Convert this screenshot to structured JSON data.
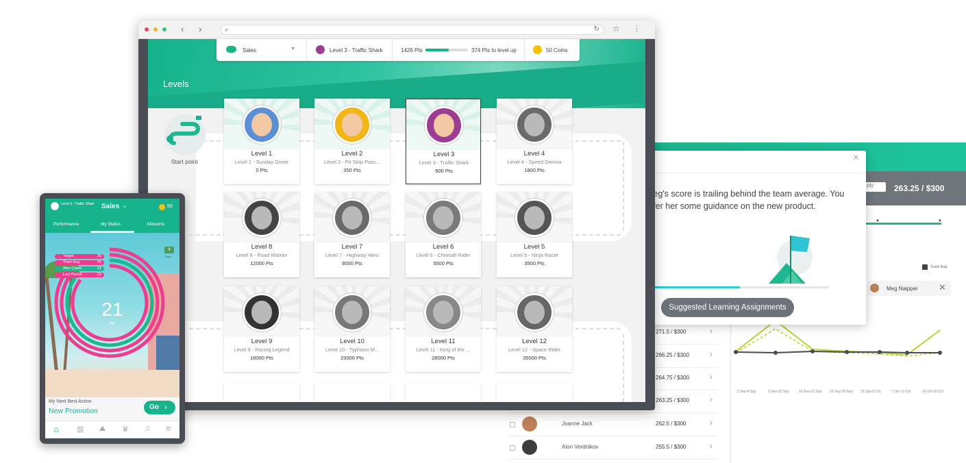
{
  "dashboard": {
    "score": "263.25 / $300",
    "period_select": "ply",
    "team_avg_label": "Team Avg.",
    "compare_user": "Meg Naipper",
    "dates": [
      "2 Sep-8 Sep",
      "9 Sep-15 Sep",
      "16 Sep-22 Sep",
      "23 Sep-29 Sep",
      "30 Sep-6 Oct",
      "7 Oct-13 Oct",
      "14 Oct-20 Oct"
    ],
    "rows": [
      {
        "name": "",
        "score": "271.5 / $300"
      },
      {
        "name": "",
        "score": "266.25 / $300"
      },
      {
        "name": "",
        "score": "264.75 / $300"
      },
      {
        "name": "",
        "score": "263.25 / $300"
      },
      {
        "name": "Joanne Jack",
        "score": "262.5 / $300"
      },
      {
        "name": "Alon Verdnikov",
        "score": "255.5 / $300"
      }
    ]
  },
  "popup": {
    "message": "Meg's score is trailing behind the team average. You offer her some guidance on the new product.",
    "button": "Suggested Learning Assignments"
  },
  "topbar": {
    "team": "Sales",
    "level": "Level 3 - Traffic Shark",
    "points": "1426 Pts",
    "progress": 0.55,
    "to_level_up": "374 Pts to level up",
    "coins": "50 Coins"
  },
  "levels_page": {
    "title": "Levels",
    "start_label": "Start point"
  },
  "levels": [
    {
      "level": "Level 1",
      "name": "Level 1 - Sunday Driver",
      "pts": "0 Pts",
      "color": "#5b8fd6"
    },
    {
      "level": "Level 2",
      "name": "Level 2 - Pit Stop Pass...",
      "pts": "350 Pts",
      "color": "#f2b619"
    },
    {
      "level": "Level 3",
      "name": "Level 3 - Traffic Shark",
      "pts": "900 Pts",
      "color": "#9c3d93"
    },
    {
      "level": "Level 4",
      "name": "Level 4 - Speed Demon",
      "pts": "1800 Pts",
      "color": "#6a6a6a"
    },
    {
      "level": "Level 8",
      "name": "Level 8 - Road Warrior",
      "pts": "12000 Pts",
      "color": "#444444"
    },
    {
      "level": "Level 7",
      "name": "Level 7 - Highway Hero",
      "pts": "8000 Pts",
      "color": "#6a6a6a"
    },
    {
      "level": "Level 6",
      "name": "Level 6 - Cheetah Rider",
      "pts": "5500 Pts",
      "color": "#7a7a7a"
    },
    {
      "level": "Level 5",
      "name": "Level 5 - Ninja Racer",
      "pts": "3500 Pts",
      "color": "#555555"
    },
    {
      "level": "Level 9",
      "name": "Level 9 - Racing Legend",
      "pts": "18000 Pts",
      "color": "#333333"
    },
    {
      "level": "Level 10",
      "name": "Level 10 - Typhoon M...",
      "pts": "23000 Pts",
      "color": "#777777"
    },
    {
      "level": "Level 11",
      "name": "Level 11 - King of the ...",
      "pts": "28000 Pts",
      "color": "#888888"
    },
    {
      "level": "Level 12",
      "name": "Level 12 - Space Rider",
      "pts": "35000 Pts",
      "color": "#666666"
    }
  ],
  "phone": {
    "level": "Level 3 - Traffic Shark",
    "team": "Sales",
    "coins": "50",
    "tabs": [
      "Performance",
      "My Status",
      "Missions"
    ],
    "legend": [
      "Target",
      "Team Avg.",
      "Alex Crane",
      "Last Period"
    ],
    "legend_values": [
      "25",
      "25",
      "21",
      "21"
    ],
    "days": "4",
    "days_label": "Days",
    "score": "21",
    "score_unit": "Pts",
    "next_action_label": "My Next Best Action",
    "next_action": "New Promotion",
    "go": "Go"
  },
  "colors": {
    "brand": "#17b38c",
    "pink": "#ec3d8e",
    "dark": "#4a4e54"
  }
}
